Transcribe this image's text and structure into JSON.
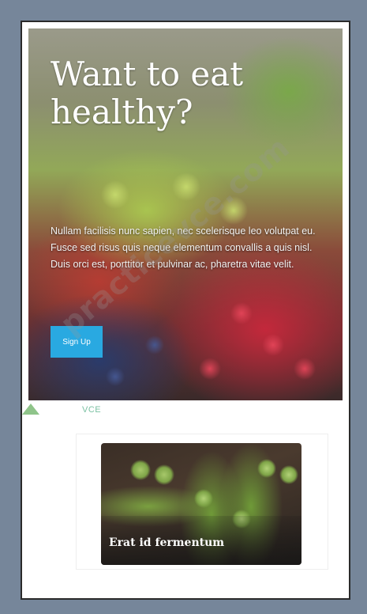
{
  "hero": {
    "title": "Want to eat healthy?",
    "body": "Nullam facilisis nunc sapien, nec scelerisque leo volutpat eu. Fusce sed risus quis neque elementum convallis a quis nisl. Duis orci est, porttitor et pulvinar ac, pharetra vitae velit.",
    "signup_label": "Sign Up"
  },
  "brand": {
    "logo_text": "VCE"
  },
  "card": {
    "title": "Erat id fermentum"
  },
  "watermark": {
    "text": "practicevce.com"
  },
  "colors": {
    "frame": "#76869a",
    "button": "#29a9e1",
    "logo": "#7cc1a3"
  }
}
